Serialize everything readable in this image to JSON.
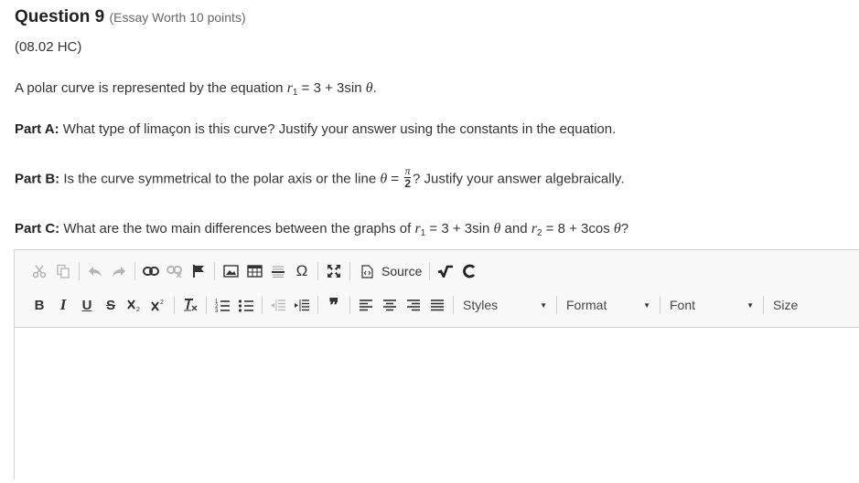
{
  "question": {
    "title": "Question 9",
    "worth": "(Essay Worth 10 points)",
    "code": "(08.02 HC)",
    "intro_text": "A polar curve is represented by the equation ",
    "intro_r": "r",
    "intro_sub": "1",
    "intro_eq": " = 3 + 3sin ",
    "intro_theta": "θ",
    "intro_end": ".",
    "partA_label": "Part A:",
    "partA_text": " What type of limaçon is this curve? Justify your answer using the constants in the equation.",
    "partB_label": "Part B:",
    "partB_text": " Is the curve symmetrical to the polar axis or the line ",
    "partB_theta": "θ",
    "partB_eq": " = ",
    "partB_num": "π",
    "partB_den": "2",
    "partB_end": "? Justify your answer algebraically.",
    "partC_label": "Part C:",
    "partC_text": " What are the two main differences between the graphs of ",
    "partC_r1": "r",
    "partC_sub1": "1",
    "partC_eq1": " = 3 + 3sin ",
    "partC_theta1": "θ",
    "partC_and": " and ",
    "partC_r2": "r",
    "partC_sub2": "2",
    "partC_eq2": " = 8 + 3cos ",
    "partC_theta2": "θ",
    "partC_end": "?"
  },
  "toolbar": {
    "source_label": "Source",
    "bold": "B",
    "italic": "I",
    "underline": "U",
    "strike": "S",
    "omega": "Ω",
    "quote": "❞",
    "styles_label": "Styles",
    "format_label": "Format",
    "font_label": "Font",
    "size_label": "Size"
  },
  "editor": {
    "value": ""
  }
}
